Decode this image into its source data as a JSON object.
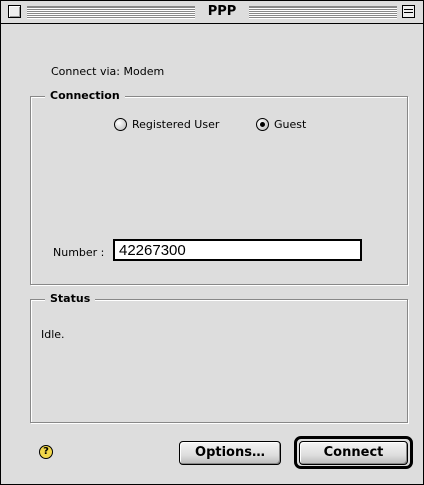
{
  "window": {
    "title": "PPP"
  },
  "connect_via": "Connect via:  Modem",
  "connection_group": {
    "title": "Connection",
    "radios": [
      {
        "label": "Registered User",
        "selected": false
      },
      {
        "label": "Guest",
        "selected": true
      }
    ],
    "number_label": "Number :",
    "number_value": "42267300"
  },
  "status_group": {
    "title": "Status",
    "text": "Idle."
  },
  "help_icon_glyph": "?",
  "buttons": {
    "options": "Options…",
    "connect": "Connect"
  },
  "icons": {
    "close": "close-box-icon",
    "collapse": "collapse-box-icon",
    "help": "help-icon"
  }
}
